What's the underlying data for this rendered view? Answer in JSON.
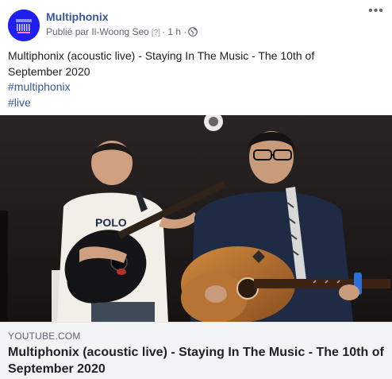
{
  "post": {
    "page_name": "Multiphonix",
    "meta": {
      "published_by": "Publié par Il-Woong Seo",
      "help": "[?]",
      "separator": "·",
      "time": "1 h",
      "separator2": "·",
      "privacy_icon": "globe-icon"
    },
    "more_icon": "ellipsis-icon",
    "text_lines": [
      "Multiphonix (acoustic live) - Staying In The Music - The 10th of",
      "September 2020"
    ],
    "hashtags": [
      "#multiphonix",
      "#live"
    ],
    "video": {
      "description": "two-guitarists-performing-image"
    },
    "link_preview": {
      "domain": "YOUTUBE.COM",
      "title": "Multiphonix (acoustic live) - Staying In The Music - The 10th of September 2020"
    }
  },
  "colors": {
    "link": "#385898",
    "meta": "#606770",
    "preview_bg": "#f2f3f5",
    "avatar_bg": "#1f1ff0"
  }
}
